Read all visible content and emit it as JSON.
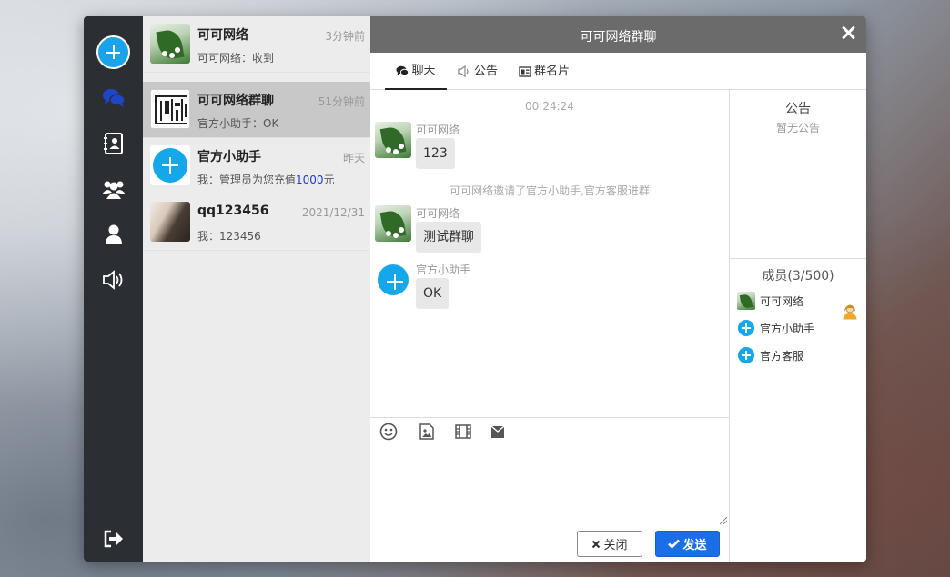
{
  "window": {
    "nav": {
      "items": [
        {
          "icon": "add-icon"
        },
        {
          "icon": "chat-bubbles-icon",
          "active": true
        },
        {
          "icon": "address-book-icon"
        },
        {
          "icon": "group-icon"
        },
        {
          "icon": "user-icon"
        },
        {
          "icon": "speaker-icon"
        },
        {
          "icon": "logout-icon"
        }
      ]
    },
    "conversations": [
      {
        "name": "可可网络",
        "time": "3分钟前",
        "message": "可可网络：收到"
      },
      {
        "name": "可可网络群聊",
        "time": "51分钟前",
        "message": "官方小助手：OK",
        "active": true
      },
      {
        "name": "官方小助手",
        "time": "昨天",
        "message_prefix": "我：管理员为您充值",
        "message_amount": "1000",
        "message_suffix": "元"
      },
      {
        "name": "qq123456",
        "time": "2021/12/31",
        "message": "我：123456"
      }
    ],
    "chat": {
      "title": "可可网络群聊",
      "tabs": [
        {
          "label": "聊天",
          "icon": "chat-bubbles-icon",
          "active": true
        },
        {
          "label": "公告",
          "icon": "speaker-icon"
        },
        {
          "label": "群名片",
          "icon": "card-icon"
        }
      ],
      "time": "00:24:24",
      "messages": [
        {
          "sender": "可可网络",
          "text": "123"
        },
        {
          "sender": "可可网络",
          "text": "测试群聊"
        },
        {
          "sender": "官方小助手",
          "text": "OK"
        }
      ],
      "system_note": "可可网络邀请了官方小助手,官方客服进群",
      "toolbar": [
        "emoji-icon",
        "image-icon",
        "video-icon",
        "envelope-icon"
      ],
      "close_label": "关闭",
      "send_label": "发送"
    },
    "side": {
      "notice_title": "公告",
      "notice_empty": "暂无公告",
      "members_title": "成员(3/500)",
      "members": [
        {
          "name": "可可网络",
          "owner": true
        },
        {
          "name": "官方小助手"
        },
        {
          "name": "官方客服"
        }
      ]
    }
  }
}
